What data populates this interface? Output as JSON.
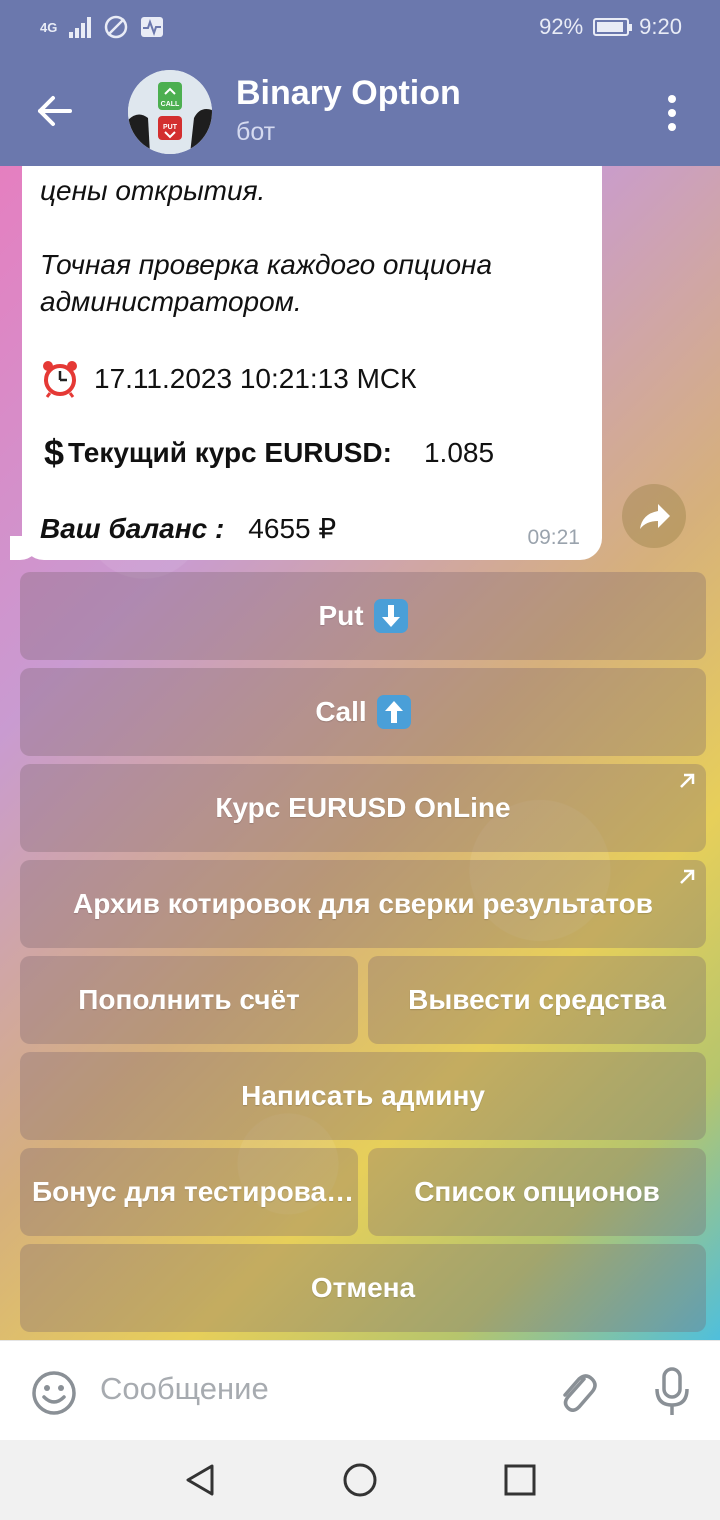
{
  "status": {
    "network": "4G",
    "battery": "92%",
    "battery_level": 0.92,
    "time": "9:20"
  },
  "header": {
    "title": "Binary Option",
    "subtitle": "бот",
    "avatar_labels": [
      "CALL",
      "PUT"
    ]
  },
  "message": {
    "line_top": "цены открытия.",
    "check_line1": "Точная проверка каждого опциона",
    "check_line2": "администратором.",
    "datetime": "17.11.2023 10:21:13  МСК",
    "rate_label": "Текущий курс EURUSD:",
    "rate_value": "1.085",
    "balance_label": "Ваш баланс :",
    "balance_value": "4655 ₽",
    "time": "09:21"
  },
  "keyboard": {
    "put": "Put",
    "call": "Call",
    "rate_online": "Курс EURUSD OnLine",
    "archive": "Архив котировок для сверки результатов",
    "deposit": "Пополнить счёт",
    "withdraw": "Вывести средства",
    "write_admin": "Написать админу",
    "bonus": "Бонус для тестирова…",
    "options_list": "Список опционов",
    "cancel": "Отмена"
  },
  "input": {
    "placeholder": "Сообщение"
  },
  "colors": {
    "header": "#6b78ad",
    "bubble": "#ffffff",
    "key_bg": "rgba(120,100,110,0.32)",
    "emoji_blue": "#4a9fd8"
  }
}
